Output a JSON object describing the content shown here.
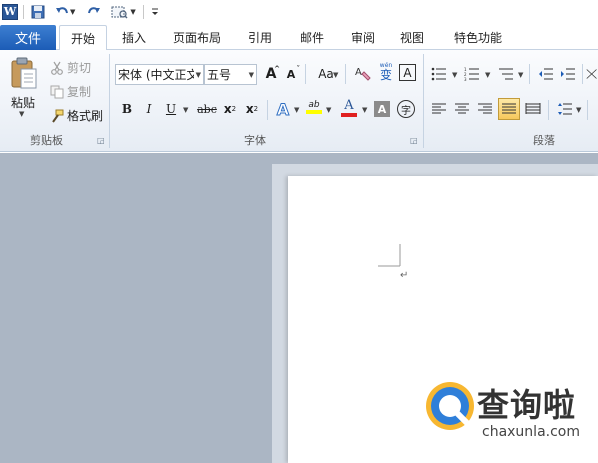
{
  "quick_access": {
    "word_logo": "W",
    "icons": [
      "save-icon",
      "undo-icon",
      "redo-icon",
      "print-preview-icon",
      "customize-toolbar-icon"
    ]
  },
  "tabs": {
    "file": "文件",
    "items": [
      "开始",
      "插入",
      "页面布局",
      "引用",
      "邮件",
      "审阅",
      "视图",
      "特色功能"
    ],
    "active": "开始"
  },
  "clipboard": {
    "paste": "粘贴",
    "cut": "剪切",
    "copy": "复制",
    "format_painter": "格式刷",
    "group_label": "剪贴板"
  },
  "font": {
    "font_name": "宋体 (中文正文",
    "font_size": "五号",
    "grow": "A",
    "shrink": "A",
    "change_case": "Aa",
    "bold": "B",
    "italic": "I",
    "underline": "U",
    "strikethrough": "abc",
    "subscript": "x",
    "subscript_mark": "2",
    "superscript": "x",
    "superscript_mark": "2",
    "text_effect": "A",
    "highlight": "ab",
    "font_color": "A",
    "char_shading": "A",
    "enclose": "字",
    "phonetic": "wén",
    "phonetic_char": "变",
    "char_border": "A",
    "group_label": "字体",
    "colors": {
      "highlight": "#ffff00",
      "font_color": "#e02020",
      "accent": "#1c5cb6"
    }
  },
  "paragraph": {
    "group_label": "段落"
  },
  "document": {
    "paragraph_mark": "↵"
  },
  "watermark": {
    "title": "查询啦",
    "url": "chaxunla.com"
  }
}
